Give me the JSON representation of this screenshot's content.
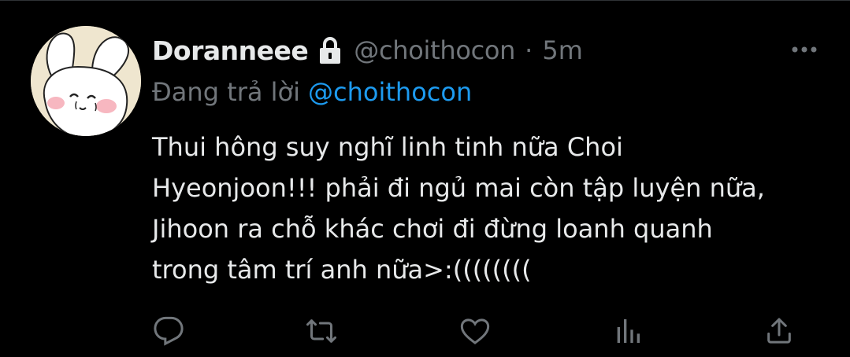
{
  "tweet": {
    "author": {
      "display_name": "Doranneee",
      "protected_icon": "lock-icon",
      "handle": "@choithocon",
      "avatar_icon": "cartoon-bunny-avatar"
    },
    "separator": "·",
    "time": "5m",
    "reply": {
      "prefix": "Đang trả lời",
      "to_handle": "@choithocon"
    },
    "text_lines": [
      "Thui hông suy nghĩ linh tinh nữa Choi",
      "Hyeonjoon!!! phải đi ngủ mai còn tập luyện nữa,",
      "Jihoon ra chỗ khác chơi đi đừng loanh quanh",
      "trong tâm trí anh nữa>:(((((((("
    ],
    "actions": [
      "reply-icon",
      "retweet-icon",
      "like-icon",
      "analytics-icon",
      "share-icon"
    ],
    "more_icon": "more-dots-icon"
  },
  "colors": {
    "background": "#000000",
    "primary_text": "#e7e9ea",
    "secondary_text": "#71767b",
    "accent": "#1d9bf0"
  }
}
